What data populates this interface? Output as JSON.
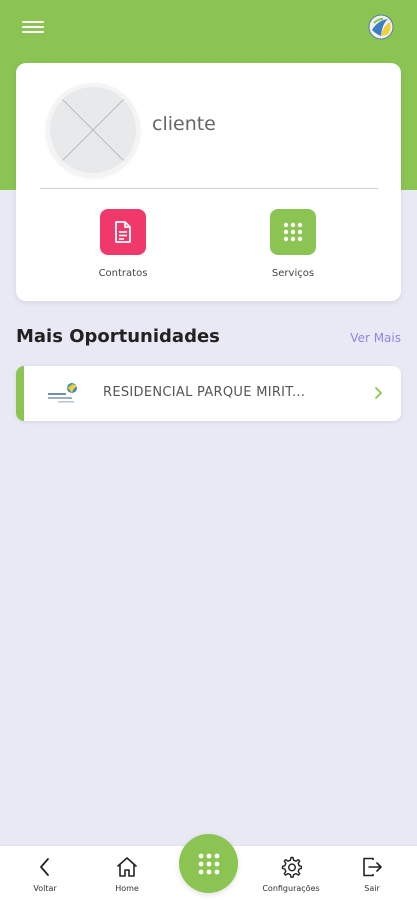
{
  "header": {
    "menu_icon": "hamburger-menu-icon",
    "logo_icon": "brand-logo-icon"
  },
  "profile": {
    "username": "cliente",
    "avatar_icon": "avatar-placeholder-icon"
  },
  "actions": [
    {
      "label": "Contratos",
      "icon": "document-icon",
      "color": "#f0386b"
    },
    {
      "label": "Serviços",
      "icon": "grid-icon",
      "color": "#8bc453"
    }
  ],
  "opportunities": {
    "title": "Mais Oportunidades",
    "see_more": "Ver Mais",
    "items": [
      {
        "label": "RESIDENCIAL PARQUE MIRIT...",
        "logo_icon": "residencial-logo-icon",
        "chevron_icon": "chevron-right-icon"
      }
    ]
  },
  "bottom_nav": {
    "back": {
      "label": "Voltar",
      "icon": "chevron-left-icon"
    },
    "home": {
      "label": "Home",
      "icon": "home-icon"
    },
    "center": {
      "icon": "grid-icon"
    },
    "config": {
      "label": "Configurações",
      "icon": "gear-icon"
    },
    "exit": {
      "label": "Sair",
      "icon": "logout-icon"
    }
  },
  "colors": {
    "brand_green": "#8bc453",
    "contracts_pink": "#f0386b",
    "link_purple": "#8f86e6",
    "background": "#e9e9f5"
  }
}
